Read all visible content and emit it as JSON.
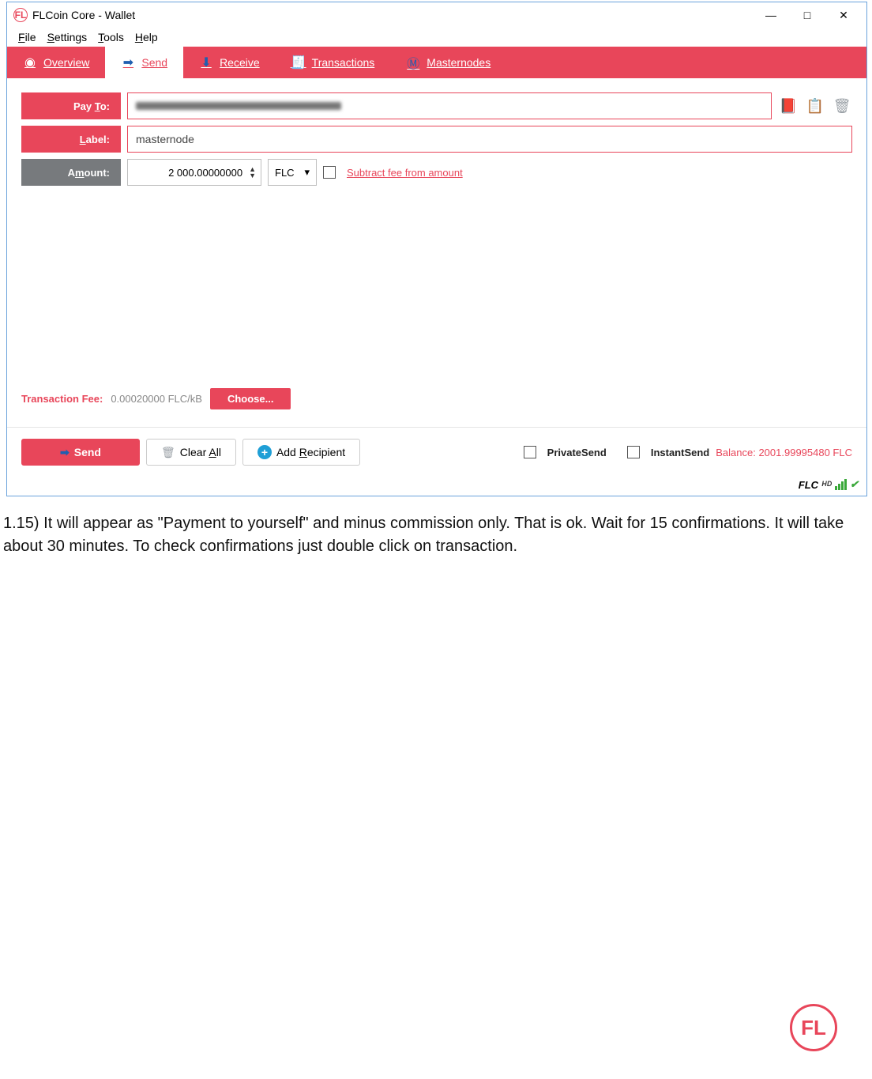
{
  "window": {
    "title": "FLCoin Core - Wallet",
    "menu": {
      "file": "File",
      "settings": "Settings",
      "tools": "Tools",
      "help": "Help"
    },
    "controls": {
      "min": "—",
      "max": "□",
      "close": "✕"
    }
  },
  "tabs": {
    "overview": "Overview",
    "send": "Send",
    "receive": "Receive",
    "transactions": "Transactions",
    "masternodes": "Masternodes"
  },
  "form": {
    "payto_label": "Pay To:",
    "payto_value": "",
    "label_label": "Label:",
    "label_value": "masternode",
    "amount_label": "Amount:",
    "amount_value": "2 000.00000000",
    "unit": "FLC",
    "subtract": "Subtract fee from amount"
  },
  "fee": {
    "label": "Transaction Fee:",
    "value": "0.00020000 FLC/kB",
    "choose": "Choose..."
  },
  "actions": {
    "send": "Send",
    "clear": "Clear All",
    "add": "Add Recipient",
    "private": "PrivateSend",
    "instant": "InstantSend"
  },
  "balance": {
    "label": "Balance:",
    "value": "2001.99995480 FLC"
  },
  "status": {
    "unit": "FLC",
    "hd": "HD"
  },
  "caption": "1.15)  It will appear as \"Payment to yourself\" and minus commission only. That is ok. Wait for 15 confirmations. It will take about 30 minutes. To check confirmations just double click on transaction.",
  "logo": "FL"
}
